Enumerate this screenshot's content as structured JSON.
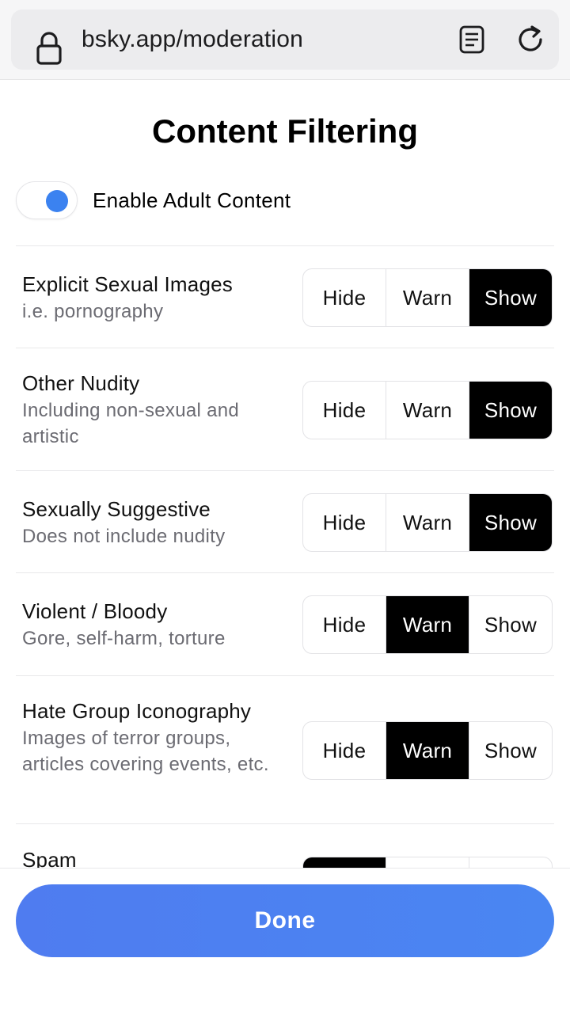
{
  "browser": {
    "url": "bsky.app/moderation"
  },
  "page": {
    "title": "Content Filtering",
    "adult_toggle": {
      "label": "Enable Adult Content",
      "on": true,
      "accent": "#3b82f0"
    }
  },
  "options": [
    "Hide",
    "Warn",
    "Show"
  ],
  "rows": [
    {
      "title": "Explicit Sexual Images",
      "desc": "i.e. pornography",
      "selected": "Show"
    },
    {
      "title": "Other Nudity",
      "desc": "Including non-sexual and artistic",
      "selected": "Show"
    },
    {
      "title": "Sexually Suggestive",
      "desc": "Does not include nudity",
      "selected": "Show"
    },
    {
      "title": "Violent / Bloody",
      "desc": "Gore, self-harm, torture",
      "selected": "Warn"
    },
    {
      "title": "Hate Group Iconography",
      "desc": "Images of terror groups, articles covering events, etc.",
      "selected": "Warn"
    },
    {
      "title": "Spam",
      "desc": "",
      "selected": "Hide"
    }
  ],
  "footer": {
    "done_label": "Done",
    "done_color": "#4a80f0"
  }
}
